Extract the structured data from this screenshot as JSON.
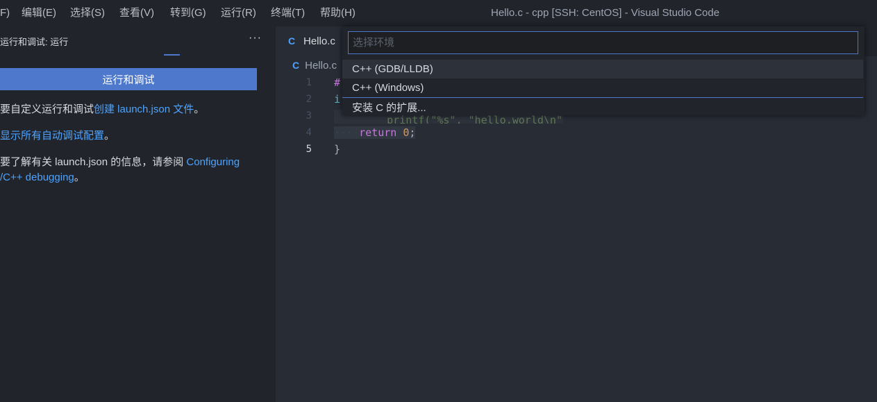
{
  "menu": {
    "items": [
      "F)",
      "编辑(E)",
      "选择(S)",
      "查看(V)",
      "转到(G)",
      "运行(R)",
      "终端(T)",
      "帮助(H)"
    ]
  },
  "window_title": "Hello.c - cpp [SSH: CentOS] - Visual Studio Code",
  "sidebar": {
    "title": "运行和调试: 运行",
    "more": "···",
    "run_button": "运行和调试",
    "p1_prefix": "要自定义运行和调试",
    "p1_link": "创建 launch.json 文件",
    "p1_suffix": "。",
    "p2_link": "显示所有自动调试配置",
    "p2_suffix": "。",
    "p3_prefix": "要了解有关 launch.json 的信息，请参阅 ",
    "p3_link_1": "Configuring",
    "p3_link_2": "/C++ debugging",
    "p3_suffix": "。"
  },
  "editor": {
    "tab_icon": "C",
    "tab_label": "Hello.c",
    "breadcrumb_icon": "C",
    "breadcrumb": "Hello.c",
    "line_numbers": [
      "1",
      "2",
      "3",
      "4",
      "5"
    ],
    "code": {
      "line1": "#",
      "line2": "i",
      "line3_fragment": "printf(\"%s\", \"hello,world\\n\");",
      "line4_ws": "····",
      "line4_kw": "return",
      "line4_num": "0",
      "line4_end": ";",
      "line5": "}"
    }
  },
  "quick_pick": {
    "placeholder": "选择环境",
    "items": [
      "C++ (GDB/LLDB)",
      "C++ (Windows)",
      "安装 C 的扩展..."
    ]
  },
  "colors": {
    "accent": "#4d78cc",
    "link": "#4da3ff",
    "keyword": "#c678dd",
    "number": "#d19a66"
  }
}
